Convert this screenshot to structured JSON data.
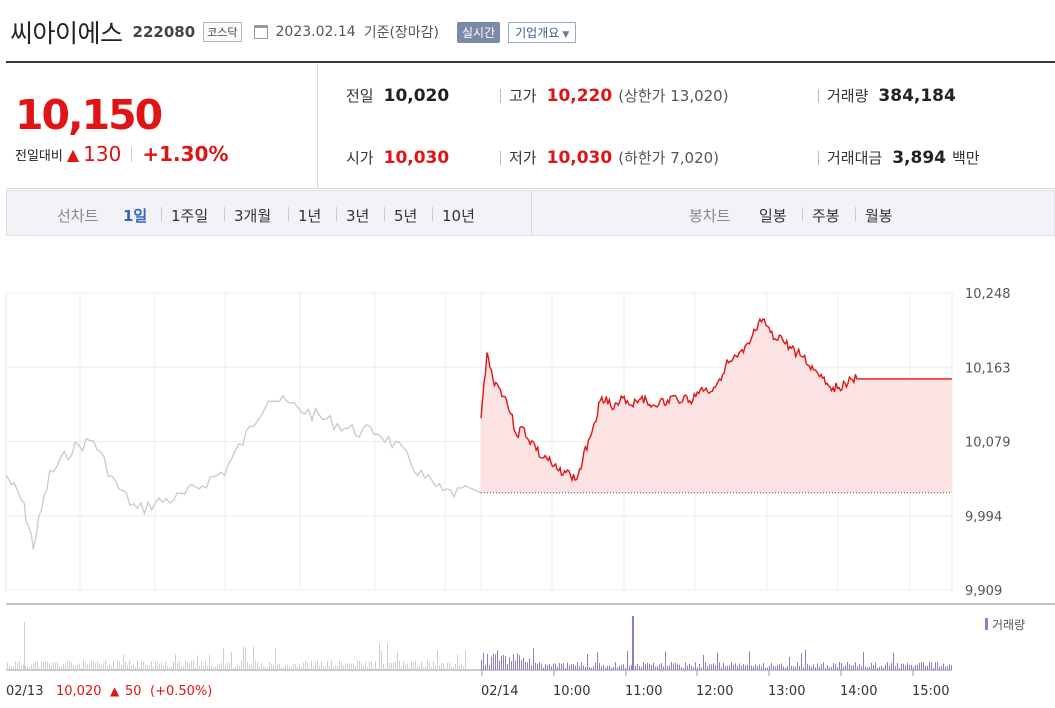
{
  "header": {
    "name": "씨아이에스",
    "code": "222080",
    "market": "코스닥",
    "date": "2023.02.14",
    "basis": "기준(장마감)",
    "realtime_label": "실시간",
    "company_label": "기업개요"
  },
  "summary": {
    "price": "10,150",
    "change_label": "전일대비",
    "change_amount": "130",
    "change_pct": "+1.30%",
    "prev_label": "전일",
    "prev": "10,020",
    "high_label": "고가",
    "high": "10,220",
    "high_limit": "(상한가 13,020)",
    "volume_label": "거래량",
    "volume": "384,184",
    "open_label": "시가",
    "open": "10,030",
    "low_label": "저가",
    "low": "10,030",
    "low_limit": "(하한가 7,020)",
    "amount_label": "거래대금",
    "amount": "3,894",
    "amount_unit": "백만"
  },
  "periods": {
    "line_label": "선차트",
    "items": [
      "1일",
      "1주일",
      "3개월",
      "1년",
      "3년",
      "5년",
      "10년"
    ],
    "candle_label": "봉차트",
    "candle_items": [
      "일봉",
      "주봉",
      "월봉"
    ]
  },
  "colors": {
    "up": "#e01414",
    "accent": "#3763c9",
    "volume": "#8a7fc8",
    "prevday": "#c9c9c9"
  },
  "chart_data": {
    "type": "line",
    "y_ticks": [
      "10,248",
      "10,163",
      "10,079",
      "9,994",
      "9,909"
    ],
    "ylim": [
      9909,
      10248
    ],
    "prev_close": 10020,
    "x_ticks": [
      "02/14",
      "10:00",
      "11:00",
      "12:00",
      "13:00",
      "14:00",
      "15:00"
    ],
    "volume_legend": "거래량",
    "prev_day_info": {
      "date": "02/13",
      "close": "10,020",
      "change": "50",
      "pct": "(+0.50%)"
    },
    "today_series": [
      [
        "09:00",
        10105
      ],
      [
        "09:05",
        10180
      ],
      [
        "09:10",
        10150
      ],
      [
        "09:15",
        10140
      ],
      [
        "09:20",
        10130
      ],
      [
        "09:25",
        10110
      ],
      [
        "09:30",
        10085
      ],
      [
        "09:35",
        10095
      ],
      [
        "09:40",
        10080
      ],
      [
        "09:45",
        10075
      ],
      [
        "09:50",
        10060
      ],
      [
        "09:55",
        10060
      ],
      [
        "10:00",
        10050
      ],
      [
        "10:05",
        10045
      ],
      [
        "10:10",
        10045
      ],
      [
        "10:15",
        10040
      ],
      [
        "10:20",
        10035
      ],
      [
        "10:25",
        10055
      ],
      [
        "10:30",
        10080
      ],
      [
        "10:35",
        10100
      ],
      [
        "10:40",
        10125
      ],
      [
        "10:45",
        10130
      ],
      [
        "10:50",
        10115
      ],
      [
        "10:55",
        10120
      ],
      [
        "11:00",
        10130
      ],
      [
        "11:05",
        10120
      ],
      [
        "11:10",
        10125
      ],
      [
        "11:15",
        10130
      ],
      [
        "11:20",
        10120
      ],
      [
        "11:25",
        10120
      ],
      [
        "11:30",
        10125
      ],
      [
        "11:35",
        10120
      ],
      [
        "11:40",
        10130
      ],
      [
        "11:45",
        10125
      ],
      [
        "11:50",
        10130
      ],
      [
        "11:55",
        10125
      ],
      [
        "12:00",
        10130
      ],
      [
        "12:05",
        10140
      ],
      [
        "12:10",
        10135
      ],
      [
        "12:15",
        10140
      ],
      [
        "12:20",
        10150
      ],
      [
        "12:25",
        10165
      ],
      [
        "12:30",
        10170
      ],
      [
        "12:35",
        10175
      ],
      [
        "12:40",
        10180
      ],
      [
        "12:45",
        10190
      ],
      [
        "12:50",
        10205
      ],
      [
        "12:55",
        10215
      ],
      [
        "13:00",
        10210
      ],
      [
        "13:05",
        10195
      ],
      [
        "13:10",
        10200
      ],
      [
        "13:15",
        10190
      ],
      [
        "13:20",
        10185
      ],
      [
        "13:25",
        10180
      ],
      [
        "13:30",
        10175
      ],
      [
        "13:35",
        10165
      ],
      [
        "13:40",
        10160
      ],
      [
        "13:45",
        10155
      ],
      [
        "13:50",
        10145
      ],
      [
        "13:55",
        10140
      ],
      [
        "14:00",
        10140
      ],
      [
        "14:05",
        10145
      ],
      [
        "14:10",
        10150
      ],
      [
        "14:15",
        10150
      ]
    ],
    "prev_series": [
      [
        0,
        10040
      ],
      [
        3,
        10010
      ],
      [
        5,
        9960
      ],
      [
        8,
        10040
      ],
      [
        12,
        10070
      ],
      [
        16,
        10080
      ],
      [
        20,
        10030
      ],
      [
        24,
        10000
      ],
      [
        28,
        10010
      ],
      [
        32,
        10015
      ],
      [
        36,
        10030
      ],
      [
        40,
        10045
      ],
      [
        44,
        10085
      ],
      [
        48,
        10130
      ],
      [
        52,
        10120
      ],
      [
        56,
        10110
      ],
      [
        60,
        10100
      ],
      [
        64,
        10090
      ],
      [
        68,
        10090
      ],
      [
        72,
        10070
      ],
      [
        76,
        10040
      ],
      [
        80,
        10020
      ],
      [
        84,
        10020
      ]
    ],
    "volume_spikes": [
      [
        11,
        3
      ],
      [
        50,
        3
      ]
    ]
  }
}
